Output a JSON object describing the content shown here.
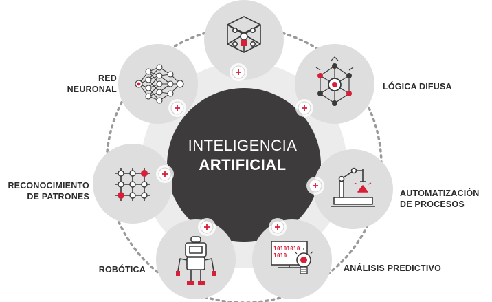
{
  "center": {
    "line1": "INTELIGENCIA",
    "line2": "ARTIFICIAL"
  },
  "nodes": {
    "red_neuronal": {
      "line1": "RED",
      "line2": "NEURONAL",
      "icon": "neural-network-icon"
    },
    "logica_difusa": {
      "line1": "LÓGICA DIFUSA",
      "icon": "fuzzy-logic-icon"
    },
    "reconocimiento": {
      "line1": "RECONOCIMIENTO",
      "line2": "DE PATRONES",
      "icon": "pattern-grid-icon"
    },
    "automatizacion": {
      "line1": "AUTOMATIZACIÓN",
      "line2": "DE PROCESOS",
      "icon": "robot-arm-icon"
    },
    "robotica": {
      "line1": "ROBÓTICA",
      "icon": "robot-icon"
    },
    "analisis": {
      "line1": "ANÁLISIS PREDICTIVO",
      "icon": "monitor-lightbulb-icon"
    },
    "top": {
      "icon": "cube-network-icon"
    },
    "monitor": {
      "text1": "10101010",
      "text2": "1010"
    }
  },
  "colors": {
    "accent": "#d71f3a",
    "dark": "#3d3b3c",
    "ring": "#e8e8e8",
    "node": "#dedede"
  }
}
